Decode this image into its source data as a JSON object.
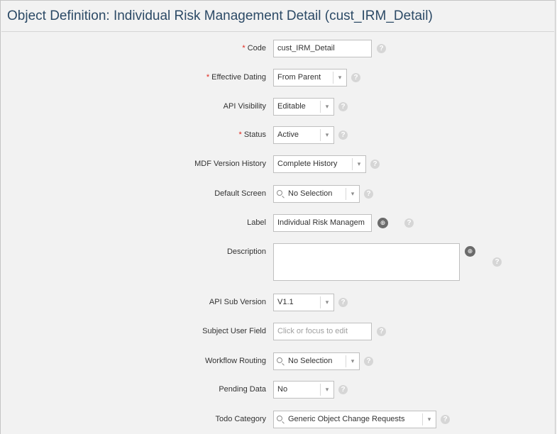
{
  "title": "Object Definition: Individual Risk Management Detail (cust_IRM_Detail)",
  "fields": {
    "code": {
      "label": "Code",
      "required": "*",
      "value": "cust_IRM_Detail"
    },
    "effective_dating": {
      "label": "Effective Dating",
      "required": "*",
      "value": "From Parent"
    },
    "api_visibility": {
      "label": "API Visibility",
      "value": "Editable"
    },
    "status": {
      "label": "Status",
      "required": "*",
      "value": "Active"
    },
    "mdf_version_history": {
      "label": "MDF Version History",
      "value": "Complete History"
    },
    "default_screen": {
      "label": "Default Screen",
      "value": "No Selection"
    },
    "label": {
      "label": "Label",
      "value": "Individual Risk Managem"
    },
    "description": {
      "label": "Description",
      "value": ""
    },
    "api_sub_version": {
      "label": "API Sub Version",
      "value": "V1.1"
    },
    "subject_user_field": {
      "label": "Subject User Field",
      "placeholder": "Click or focus to edit"
    },
    "workflow_routing": {
      "label": "Workflow Routing",
      "value": "No Selection"
    },
    "pending_data": {
      "label": "Pending Data",
      "value": "No"
    },
    "todo_category": {
      "label": "Todo Category",
      "value": "Generic Object Change Requests"
    }
  },
  "icons": {
    "help": "?",
    "chevron": "▾",
    "globe": "⊕"
  },
  "colors": {
    "required": "#e0251b",
    "title": "#2c4a66",
    "help_icon": "#d6d6d6",
    "globe_icon": "#6b6b6b"
  }
}
